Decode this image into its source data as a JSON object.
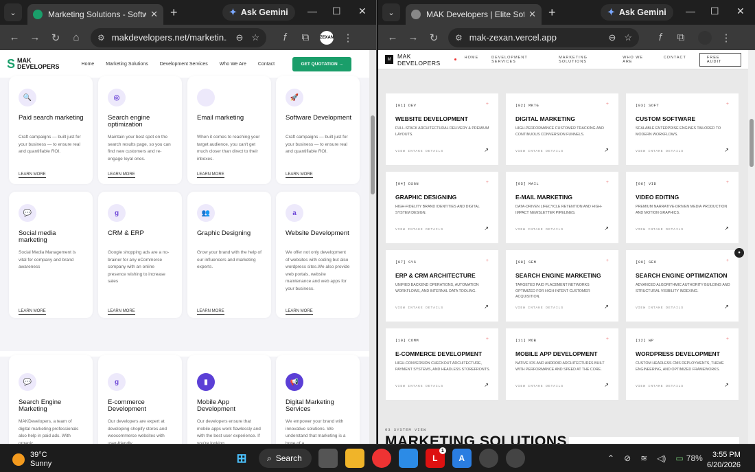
{
  "left_window": {
    "tab_title": "Marketing Solutions - Software",
    "url": "makdevelopers.net/marketin...",
    "gemini_label": "Ask Gemini",
    "avatar": "ZEXAN",
    "site": {
      "logo_line1": "MAK",
      "logo_line2": "DEVELOPERS",
      "nav": [
        "Home",
        "Marketing Solutions",
        "Development Services",
        "Who We Are",
        "Contact"
      ],
      "cta": "GET QUOTATION",
      "learn_more": "LEARN MORE",
      "cards": [
        {
          "icon": "search-icon",
          "glyph": "🔍",
          "title": "Paid search marketing",
          "desc": "Craft campaigns — built just for your business — to ensure real and quantifiable ROI."
        },
        {
          "icon": "target-icon",
          "glyph": "◎",
          "title": "Search engine optimization",
          "desc": "Maintain your best spot on the search results page, so you can find new customers and re-engage loyal ones."
        },
        {
          "icon": "mail-icon",
          "glyph": "",
          "title": "Email marketing",
          "desc": "When it comes to reaching your target audience, you can't get much closer than direct to their inboxes."
        },
        {
          "icon": "rocket-icon",
          "glyph": "🚀",
          "title": "Software Development",
          "desc": "Craft campaigns — built just for your business — to ensure real and quantifiable ROI."
        },
        {
          "icon": "chat-icon",
          "glyph": "💬",
          "title": "Social media marketing",
          "desc": "Social Media Management is vital for company and brand awareness"
        },
        {
          "icon": "google-icon",
          "glyph": "g",
          "title": "CRM & ERP",
          "desc": "Google shopping ads are a no-brainer for any eCommerce company with an online presence wishing to increase sales"
        },
        {
          "icon": "people-icon",
          "glyph": "👥",
          "title": "Graphic Designing",
          "desc": "Grow your brand with the help of our influencers and marketing experts."
        },
        {
          "icon": "amazon-icon",
          "glyph": "a",
          "title": "Website Development",
          "desc": "We offer not only development of websites with coding but also wordpress sites.We also provide web portals, website maintenance and web apps for your business."
        },
        {
          "icon": "chat-icon",
          "glyph": "💬",
          "title": "Search Engine Marketing",
          "desc": "MAKDevelopers, a team of digital marketing professionals also help in paid ads. With organic"
        },
        {
          "icon": "google-icon",
          "glyph": "g",
          "title": "E-commerce Development",
          "desc": "Our developers are expert at developing shopify stores and woocommerce websites with user-friendly"
        },
        {
          "icon": "mobile-icon",
          "glyph": "▮",
          "title": "Mobile App Development",
          "desc": "Our developers ensure that mobile apps work flawlessly and with the best user experience. If you're looking"
        },
        {
          "icon": "megaphone-icon",
          "glyph": "📢",
          "title": "Digital Marketing Services",
          "desc": "We empower your brand with innovative solutions. We understand that marketing is a bone of a"
        }
      ]
    }
  },
  "right_window": {
    "tab_title": "MAK Developers | Elite Software",
    "url": "mak-zexan.vercel.app",
    "gemini_label": "Ask Gemini",
    "site": {
      "logo_mark": "M",
      "brand": "MAK DEVELOPERS",
      "nav": [
        "HOME",
        "DEVELOPMENT SERVICES",
        "MARKETING SOLUTIONS",
        "WHO WE ARE",
        "CONTACT"
      ],
      "cta": "FREE AUDIT",
      "view_label": "VIEW INTAKE DETAILS",
      "cards": [
        {
          "code": "[01] DEV",
          "title": "WEBSITE DEVELOPMENT",
          "desc": "Full-stack architectural delivery & premium layouts."
        },
        {
          "code": "[02] MKTG",
          "title": "DIGITAL MARKETING",
          "desc": "High-performance customer tracking and continuous conversion funnels."
        },
        {
          "code": "[03] SOFT",
          "title": "CUSTOM SOFTWARE",
          "desc": "Scalable enterprise engines tailored to modern workflows."
        },
        {
          "code": "[04] DSGN",
          "title": "GRAPHIC DESIGNING",
          "desc": "High-fidelity brand identities and digital system design."
        },
        {
          "code": "[05] MAIL",
          "title": "E-MAIL MARKETING",
          "desc": "Data-driven lifecycle retention and high-impact newsletter pipelines."
        },
        {
          "code": "[06] VID",
          "title": "VIDEO EDITING",
          "desc": "Premium narrative-driven media production and motion graphics."
        },
        {
          "code": "[07] SYS",
          "title": "ERP & CRM ARCHITECTURE",
          "desc": "Unified backend operations, automation workflows, and internal data tooling."
        },
        {
          "code": "[08] SEM",
          "title": "SEARCH ENGINE MARKETING",
          "desc": "Targeted paid placement networks optimized for high-intent customer acquisition."
        },
        {
          "code": "[09] SEO",
          "title": "SEARCH ENGINE OPTIMIZATION",
          "desc": "Advanced algorithmic authority building and structural visibility indexing."
        },
        {
          "code": "[10] COMM",
          "title": "E-COMMERCE DEVELOPMENT",
          "desc": "High-conversion checkout architecture, payment systems, and headless storefronts."
        },
        {
          "code": "[11] MOB",
          "title": "MOBILE APP DEVELOPMENT",
          "desc": "Native iOS and Android architectures built with performance and speed at the core."
        },
        {
          "code": "[12] WP",
          "title": "WORDPRESS DEVELOPMENT",
          "desc": "Custom headless CMS deployments, theme engineering, and optimized frameworks."
        }
      ],
      "section_label": "03 SYSTEM VIEW",
      "section_heading": "MARKETING SOLUTIONS"
    }
  },
  "taskbar": {
    "temperature": "39°C",
    "condition": "Sunny",
    "search_label": "Search",
    "battery": "78%",
    "time": "3:55 PM",
    "date": "6/20/2026",
    "badge": "1"
  }
}
